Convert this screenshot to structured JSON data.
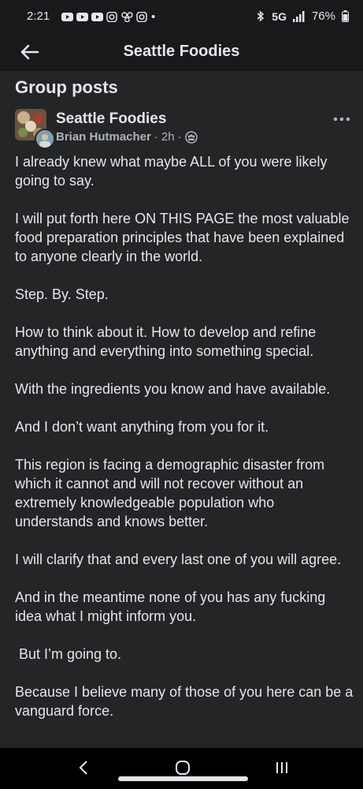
{
  "status_bar": {
    "time": "2:21",
    "network": "5G",
    "battery": "76%",
    "icons": [
      "youtube-icon",
      "youtube-icon",
      "youtube-icon",
      "instagram-icon",
      "app-icon",
      "instagram-icon"
    ]
  },
  "app_bar": {
    "title": "Seattle Foodies"
  },
  "section": {
    "title": "Group posts"
  },
  "post": {
    "group_name": "Seattle Foodies",
    "author": "Brian Hutmacher",
    "time_ago": "2h",
    "separator": "·",
    "paragraphs": [
      "I already knew what maybe ALL of you were likely going to say.",
      "I will put forth here ON THIS PAGE the most valuable food preparation principles that have been explained to anyone clearly in the world.",
      "Step. By. Step.",
      "How to think about it.  How to develop and refine anything and everything into something special.",
      "With the ingredients you know and have available.",
      "And I don’t want anything from you for it.",
      "This region is facing a demographic disaster from which it cannot and will not recover without an extremely knowledgeable population who understands and knows better.",
      "I will clarify that and every last one of you will agree.",
      "And in the meantime none of you has any fucking idea what I might inform you.",
      " But I’m going to.",
      "Because I believe many of those of you here can be a vanguard force."
    ]
  },
  "colors": {
    "background": "#242526",
    "bar": "#18191a",
    "text": "#e4e6eb",
    "muted": "#b0b3b8"
  }
}
